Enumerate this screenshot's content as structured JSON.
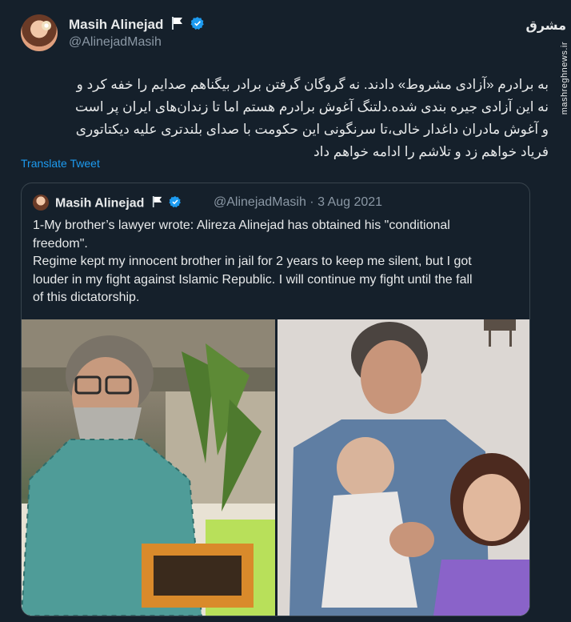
{
  "author": {
    "name": "Masih Alinejad",
    "handle": "@AlinejadMasih"
  },
  "tweet": {
    "lines": [
      "به برادرم «آزادی مشروط» دادند. نه گروگان گرفتن برادر بیگناهم صدایم را خفه کرد و",
      "نه این آزادی جیره بندی شده.دلتنگ آغوش برادرم هستم اما تا زندان‌های ایران پر است",
      "و آغوش مادران داغدار خالی،تا سرنگونی این حکومت با صدای بلندتری علیه دیکتاتوری",
      "فریاد خواهم زد و تلاشم را ادامه خواهم داد"
    ],
    "translate_label": "Translate Tweet"
  },
  "quoted": {
    "name": "Masih Alinejad",
    "handle_date": "@AlinejadMasih · 3 Aug 2021",
    "lines": [
      "1-My brother’s lawyer wrote: Alireza Alinejad has obtained his \"conditional",
      "freedom\".",
      "Regime kept my innocent brother in jail for 2 years to keep me silent, but I got",
      "louder in my fight against Islamic Republic. I will continue my fight until the fall",
      "of this dictatorship."
    ]
  },
  "watermark": {
    "logo": "مشرق",
    "site": "mashreghnews.ir"
  },
  "colors": {
    "background": "#15202b",
    "accent": "#1d9bf0",
    "text": "#e7e9ea",
    "muted": "#8b98a5",
    "border": "#38444d"
  }
}
